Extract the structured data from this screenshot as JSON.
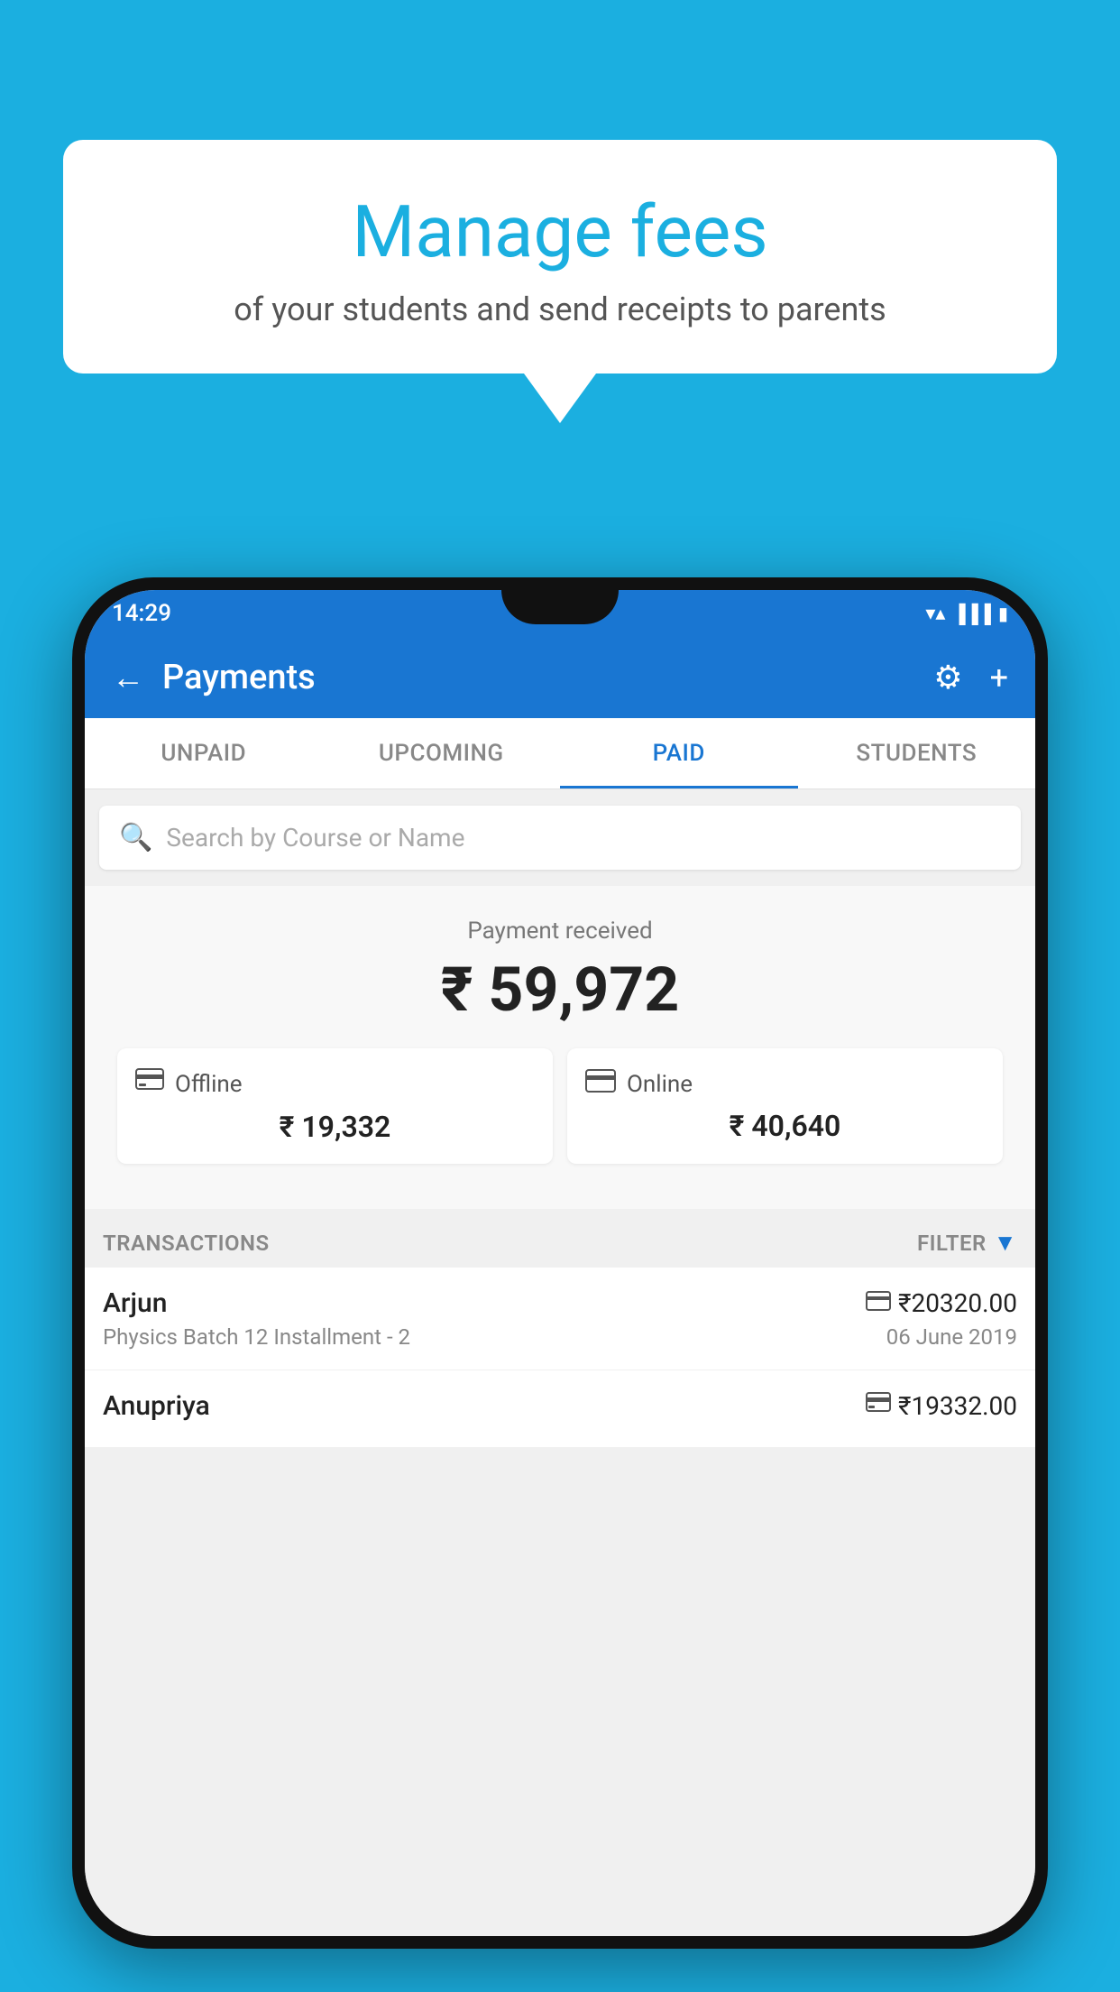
{
  "background": {
    "color": "#1BAFE0"
  },
  "speech_bubble": {
    "title": "Manage fees",
    "subtitle": "of your students and send receipts to parents"
  },
  "phone": {
    "status_bar": {
      "time": "14:29",
      "icons": [
        "wifi",
        "signal",
        "battery"
      ]
    },
    "header": {
      "title": "Payments",
      "back_label": "←",
      "settings_label": "⚙",
      "add_label": "+"
    },
    "tabs": [
      {
        "label": "UNPAID",
        "active": false
      },
      {
        "label": "UPCOMING",
        "active": false
      },
      {
        "label": "PAID",
        "active": true
      },
      {
        "label": "STUDENTS",
        "active": false
      }
    ],
    "search": {
      "placeholder": "Search by Course or Name"
    },
    "payment_summary": {
      "label": "Payment received",
      "amount": "₹ 59,972",
      "offline": {
        "label": "Offline",
        "amount": "₹ 19,332"
      },
      "online": {
        "label": "Online",
        "amount": "₹ 40,640"
      }
    },
    "transactions": {
      "header_label": "TRANSACTIONS",
      "filter_label": "FILTER",
      "items": [
        {
          "name": "Arjun",
          "course": "Physics Batch 12 Installment - 2",
          "amount": "₹20320.00",
          "date": "06 June 2019",
          "mode": "online"
        },
        {
          "name": "Anupriya",
          "course": "",
          "amount": "₹19332.00",
          "date": "",
          "mode": "offline"
        }
      ]
    }
  }
}
